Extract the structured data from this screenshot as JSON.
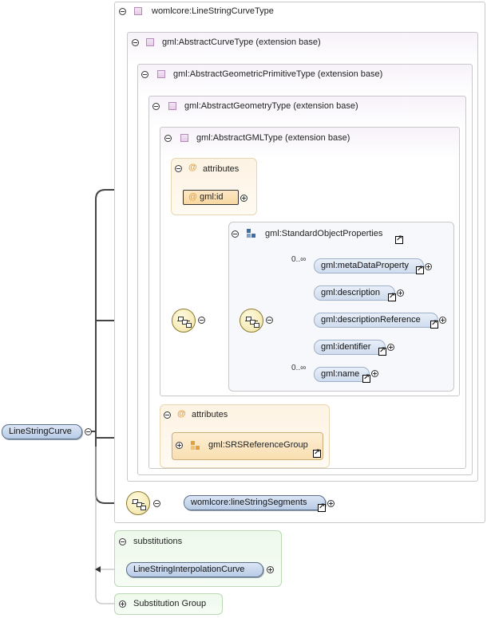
{
  "root": {
    "label": "LineStringCurve"
  },
  "outer_type": {
    "label": "womlcore:LineStringCurveType"
  },
  "abstract_curve": {
    "label": "gml:AbstractCurveType (extension base)"
  },
  "abstract_geom_prim": {
    "label": "gml:AbstractGeometricPrimitiveType (extension base)"
  },
  "abstract_geometry": {
    "label": "gml:AbstractGeometryType (extension base)"
  },
  "abstract_gml": {
    "label": "gml:AbstractGMLType (extension base)"
  },
  "attributes_1": {
    "header": "attributes",
    "attr_label": "gml:id"
  },
  "std_props": {
    "label": "gml:StandardObjectProperties",
    "elements": [
      {
        "label": "gml:metaDataProperty",
        "cardinality": "0..∞"
      },
      {
        "label": "gml:description",
        "cardinality": ""
      },
      {
        "label": "gml:descriptionReference",
        "cardinality": ""
      },
      {
        "label": "gml:identifier",
        "cardinality": ""
      },
      {
        "label": "gml:name",
        "cardinality": "0..∞"
      }
    ]
  },
  "attributes_2": {
    "header": "attributes",
    "group_label": "gml:SRSReferenceGroup"
  },
  "segments": {
    "label": "womlcore:lineStringSegments"
  },
  "substitutions": {
    "header": "substitutions",
    "item": "LineStringInterpolationCurve"
  },
  "subst_group": {
    "label": "Substitution Group"
  }
}
